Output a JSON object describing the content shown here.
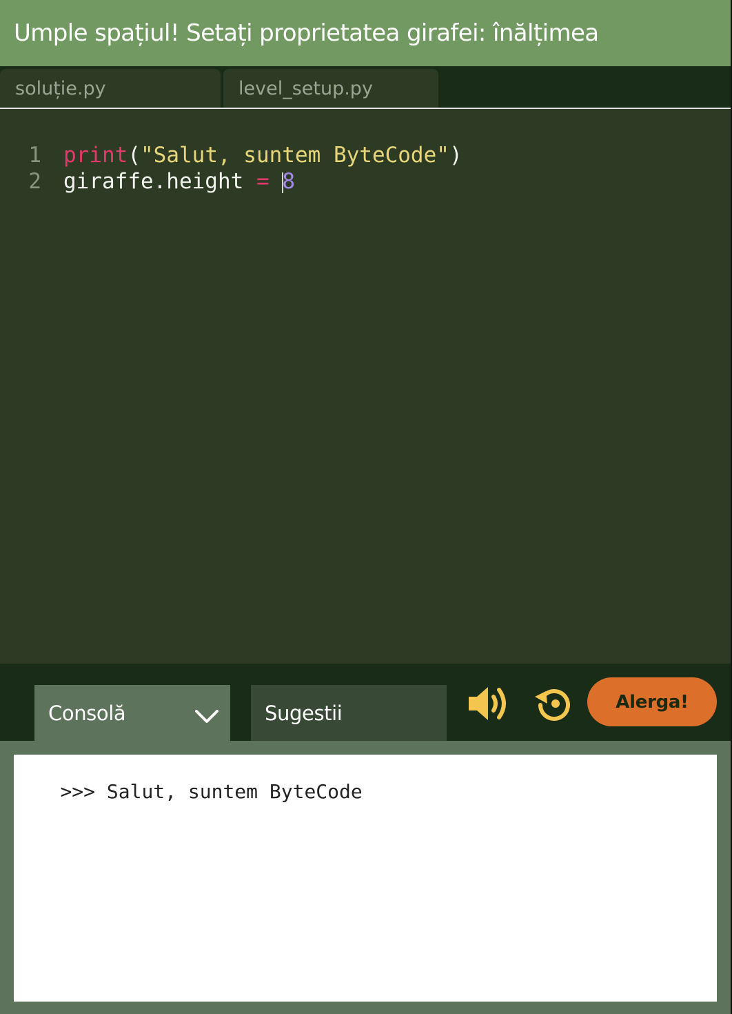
{
  "header": {
    "title": "Umple spațiul! Setați proprietatea girafei: înălțimea"
  },
  "file_tabs": [
    {
      "label": "soluție.py"
    },
    {
      "label": "level_setup.py"
    }
  ],
  "editor": {
    "lines": [
      {
        "number": "1",
        "tokens": {
          "func": "print",
          "open": "(",
          "string": "\"Salut, suntem ByteCode\"",
          "close": ")"
        }
      },
      {
        "number": "2",
        "tokens": {
          "target": "giraffe.height ",
          "op": "=",
          "space": " ",
          "value": "8"
        }
      }
    ]
  },
  "bottom_bar": {
    "console_tab": "Consolă",
    "hints_tab": "Sugestii",
    "run_label": "Alerga!",
    "icons": {
      "chevron": "chevron-down-icon",
      "sound": "speaker-icon",
      "reset": "reset-icon"
    }
  },
  "console": {
    "output": ">>> Salut, suntem ByteCode"
  },
  "colors": {
    "header_bg": "#739963",
    "editor_bg": "#2d3b25",
    "tabbar_bg": "#182c18",
    "keyword": "#e5386a",
    "string": "#e8d679",
    "number": "#a487ef",
    "run_button": "#dc702b",
    "icon_yellow": "#f5c64e"
  }
}
